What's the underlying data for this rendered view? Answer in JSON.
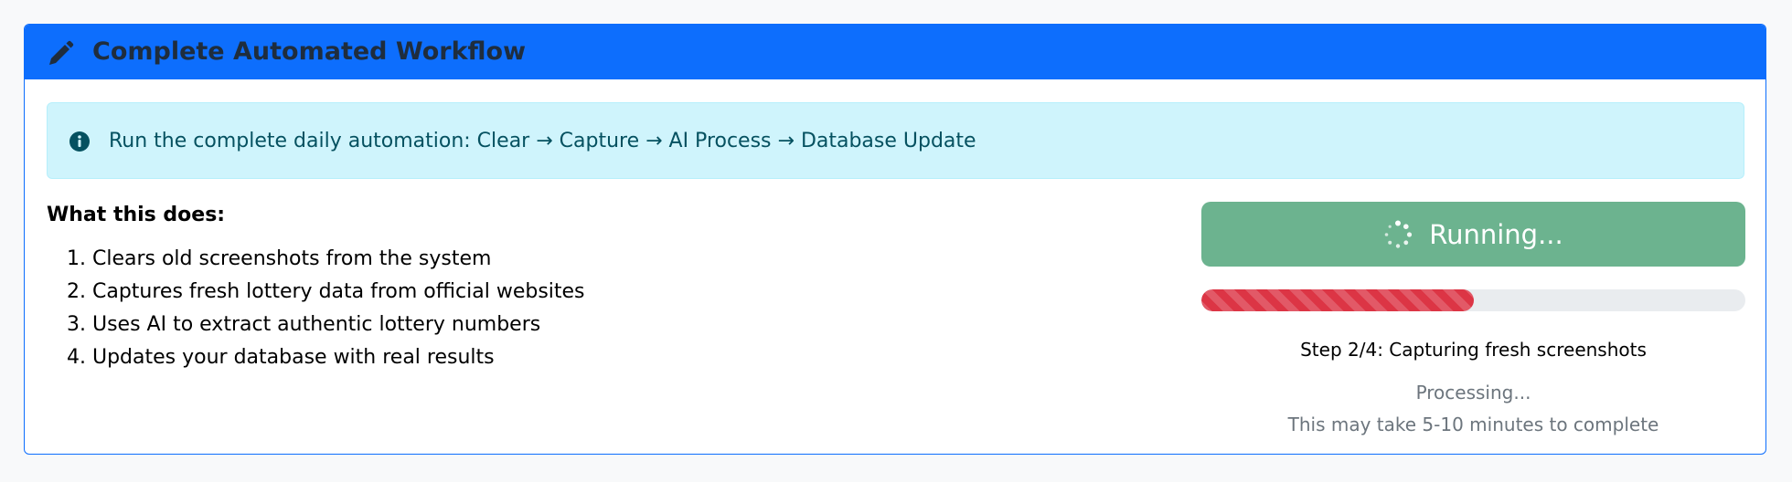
{
  "card": {
    "title": "Complete Automated Workflow",
    "icon": "pencil-icon"
  },
  "alert": {
    "icon": "info-circle-icon",
    "text": "Run the complete daily automation: Clear → Capture → AI Process → Database Update"
  },
  "description": {
    "heading": "What this does:",
    "steps": [
      "1. Clears old screenshots from the system",
      "2. Captures fresh lottery data from official websites",
      "3. Uses AI to extract authentic lottery numbers",
      "4. Updates your database with real results"
    ]
  },
  "runner": {
    "button_label": "Running...",
    "progress_percent": 50,
    "step_status": "Step 2/4: Capturing fresh screenshots",
    "processing_text": "Processing...",
    "duration_note": "This may take 5-10 minutes to complete"
  },
  "colors": {
    "header": "#0d6efd",
    "alert_bg": "#cff4fc",
    "alert_text": "#055160",
    "button": "#6cb38f",
    "progress_fill": "#dc3545"
  }
}
